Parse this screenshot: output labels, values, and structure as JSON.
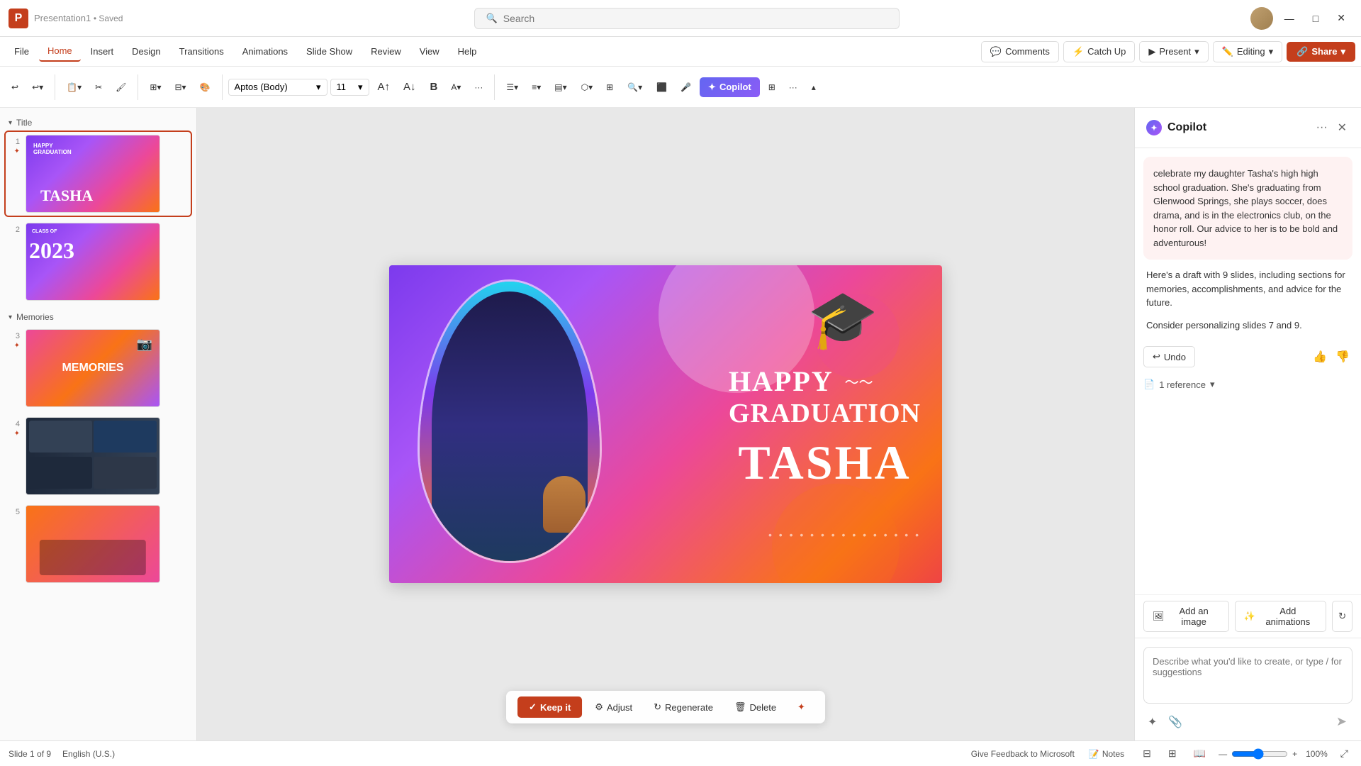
{
  "titlebar": {
    "logo_text": "P",
    "app_name": "Presentation1",
    "saved_status": "• Saved",
    "search_placeholder": "Search"
  },
  "menubar": {
    "items": [
      "File",
      "Home",
      "Insert",
      "Design",
      "Transitions",
      "Animations",
      "Slide Show",
      "Review",
      "View",
      "Help"
    ],
    "active_item": "Home",
    "catch_up_label": "Catch Up",
    "present_label": "Present",
    "editing_label": "Editing",
    "share_label": "Share",
    "comments_label": "Comments"
  },
  "ribbon": {
    "font_name": "Aptos (Body)",
    "font_size": "11",
    "copilot_label": "Copilot"
  },
  "slides": {
    "sections": [
      {
        "name": "Title",
        "expanded": true,
        "slides": [
          {
            "num": "1",
            "preview_type": "grad",
            "label": "Happy Graduation Tasha"
          },
          {
            "num": "2",
            "preview_type": "class2023",
            "label": "Class of 2023"
          }
        ]
      },
      {
        "name": "Memories",
        "expanded": true,
        "slides": [
          {
            "num": "3",
            "preview_type": "memories",
            "label": "Memories"
          },
          {
            "num": "4",
            "preview_type": "photos",
            "label": "Photo collage"
          },
          {
            "num": "5",
            "preview_type": "group",
            "label": "Group photo"
          }
        ]
      }
    ],
    "status": "Slide 1 of 9"
  },
  "slide": {
    "happy_graduation": "HAPPY GRADUATION",
    "tasha_name": "TASHA",
    "wave_symbol": "~~~"
  },
  "action_bar": {
    "keep_label": "Keep it",
    "adjust_label": "Adjust",
    "regenerate_label": "Regenerate",
    "delete_label": "Delete"
  },
  "copilot": {
    "title": "Copilot",
    "logo_letter": "✦",
    "user_message": "celebrate my daughter Tasha's high high school graduation. She's graduating from Glenwood Springs, she plays soccer, does drama, and is in the electronics club, on the honor roll. Our advice to her is to be bold and adventurous!",
    "ai_response_1": "Here's a draft with 9 slides, including sections for memories, accomplishments, and advice for the future.",
    "ai_response_2": "Consider personalizing slides 7 and 9.",
    "undo_label": "Undo",
    "reference_label": "1 reference",
    "add_image_label": "Add an image",
    "add_animations_label": "Add animations",
    "input_placeholder": "Describe what you'd like to create, or type / for suggestions"
  },
  "statusbar": {
    "slide_info": "Slide 1 of 9",
    "language": "English (U.S.)",
    "feedback_label": "Give Feedback to Microsoft",
    "notes_label": "Notes",
    "zoom_level": "100%"
  }
}
